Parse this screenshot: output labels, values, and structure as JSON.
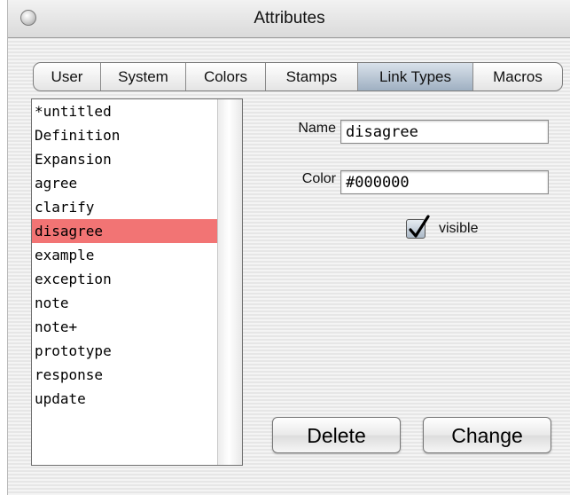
{
  "window": {
    "title": "Attributes"
  },
  "tabs": [
    {
      "label": "User"
    },
    {
      "label": "System"
    },
    {
      "label": "Colors"
    },
    {
      "label": "Stamps"
    },
    {
      "label": "Link Types",
      "selected": true
    },
    {
      "label": "Macros"
    }
  ],
  "link_types": [
    "*untitled",
    "Definition",
    "Expansion",
    "agree",
    "clarify",
    "disagree",
    "example",
    "exception",
    "note",
    "note+",
    "prototype",
    "response",
    "update"
  ],
  "selected_link_type": "disagree",
  "form": {
    "name_label": "Name",
    "name_value": "disagree",
    "color_label": "Color",
    "color_value": "#000000",
    "visible_label": "visible",
    "visible_checked": true
  },
  "buttons": {
    "delete": "Delete",
    "change": "Change"
  },
  "colors": {
    "selection": "#f27474",
    "selected_tab": "#9fb0c2"
  },
  "icons": {
    "close": "close-icon",
    "check": "checkmark-icon"
  }
}
